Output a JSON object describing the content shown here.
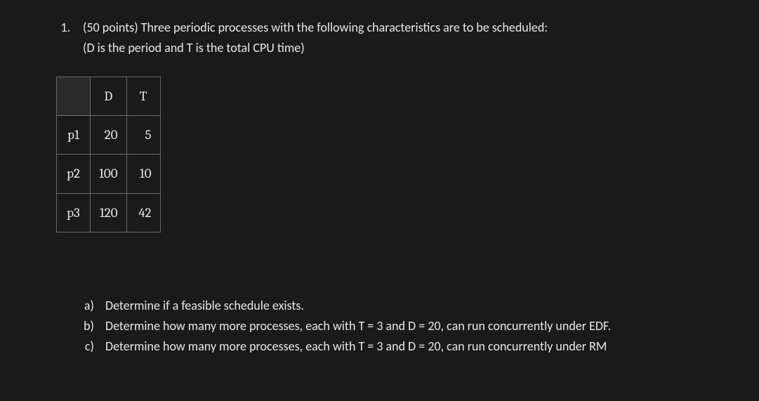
{
  "question": {
    "number": "1.",
    "points_line": "(50 points) Three periodic processes with the following characteristics are to be scheduled:",
    "note_line": "(D is the period and T is the total CPU time)"
  },
  "table": {
    "headers": [
      "",
      "D",
      "T"
    ],
    "rows": [
      {
        "label": "p1",
        "d": "20",
        "t": "5"
      },
      {
        "label": "p2",
        "d": "100",
        "t": "10"
      },
      {
        "label": "p3",
        "d": "120",
        "t": "42"
      }
    ]
  },
  "subparts": [
    {
      "label": "a)",
      "text": "Determine if a feasible schedule exists."
    },
    {
      "label": "b)",
      "text": "Determine how many more processes, each with T = 3 and D = 20, can run concurrently under EDF."
    },
    {
      "label": "c)",
      "text": "Determine how many more processes, each with T = 3 and D = 20, can run concurrently under RM"
    }
  ]
}
